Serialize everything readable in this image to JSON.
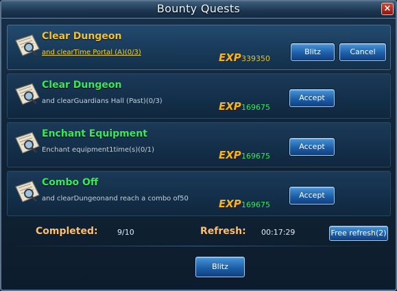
{
  "window": {
    "title": "Bounty Quests",
    "close_label": "×"
  },
  "quests": [
    {
      "name": "Clear Dungeon",
      "description": "and clearTime Portal (A)(0/3)",
      "exp_label": "EXP",
      "exp_value": "339350",
      "buttons": [
        "Blitz",
        "Cancel"
      ]
    },
    {
      "name": "Clear Dungeon",
      "description": "and clearGuardians Hall (Past)(0/3)",
      "exp_label": "EXP",
      "exp_value": "169675",
      "buttons": [
        "Accept"
      ]
    },
    {
      "name": "Enchant Equipment",
      "description": "Enchant equipment1time(s)(0/1)",
      "exp_label": "EXP",
      "exp_value": "169675",
      "buttons": [
        "Accept"
      ]
    },
    {
      "name": "Combo Off",
      "description": "and clearDungeonand reach a combo of50",
      "exp_label": "EXP",
      "exp_value": "169675",
      "buttons": [
        "Accept"
      ]
    }
  ],
  "footer": {
    "completed_label": "Completed:",
    "completed_value": "9/10",
    "refresh_label": "Refresh:",
    "refresh_timer": "00:17:29",
    "free_refresh_label": "Free refresh(2)",
    "blitz_label": "Blitz"
  },
  "colors": {
    "quest_name_active": "#f2c230",
    "quest_name": "#39e85c",
    "exp_label": "#f3b623",
    "button_blue": "#1c5fa8"
  }
}
